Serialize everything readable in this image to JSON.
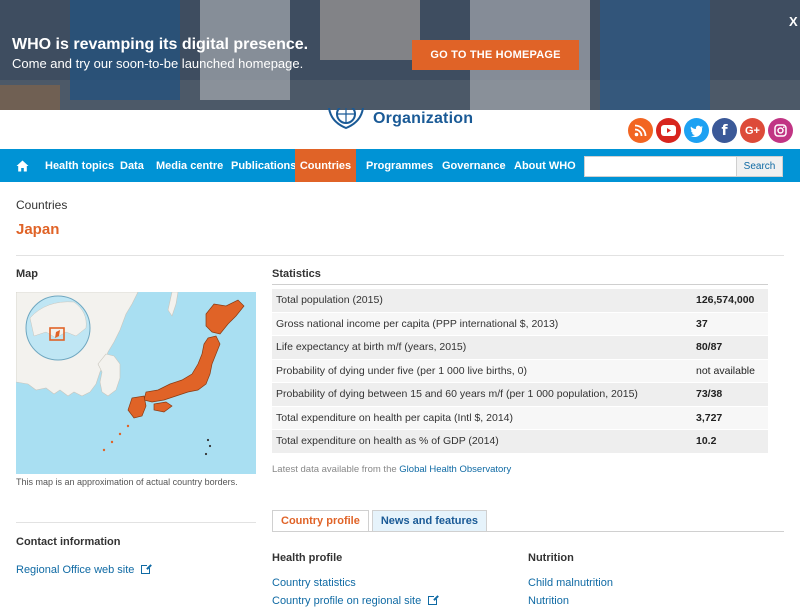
{
  "banner": {
    "title": "WHO is revamping its digital presence.",
    "subtitle": "Come and try our soon-to-be launched homepage.",
    "button": "GO TO THE HOMEPAGE",
    "close": "X"
  },
  "header": {
    "logo_text": "Organization",
    "social_icons": [
      "rss-icon",
      "youtube-icon",
      "twitter-icon",
      "facebook-icon",
      "google-plus-icon",
      "instagram-icon"
    ]
  },
  "nav": {
    "items": [
      "Health topics",
      "Data",
      "Media centre",
      "Publications",
      "Countries",
      "Programmes",
      "Governance",
      "About WHO"
    ],
    "active": "Countries",
    "search_button": "Search",
    "search_placeholder": ""
  },
  "page": {
    "breadcrumb": "Countries",
    "title": "Japan"
  },
  "map": {
    "heading": "Map",
    "caption": "This map is an approximation of actual country borders."
  },
  "stats": {
    "heading": "Statistics",
    "rows": [
      {
        "label": "Total population (2015)",
        "value": "126,574,000"
      },
      {
        "label": "Gross national income per capita (PPP international $, 2013)",
        "value": "37"
      },
      {
        "label": "Life expectancy at birth m/f (years, 2015)",
        "value": "80/87"
      },
      {
        "label": "Probability of dying under five (per 1 000 live births, 0)",
        "value": "not available"
      },
      {
        "label": "Probability of dying between 15 and 60 years m/f (per 1 000 population, 2015)",
        "value": "73/38"
      },
      {
        "label": "Total expenditure on health per capita (Intl $, 2014)",
        "value": "3,727"
      },
      {
        "label": "Total expenditure on health as % of GDP (2014)",
        "value": "10.2"
      }
    ],
    "latest_prefix": "Latest data available from the",
    "latest_link": "Global Health Observatory"
  },
  "tabs": [
    "Country profile",
    "News and features"
  ],
  "contact": {
    "heading": "Contact information",
    "regional_link": "Regional Office web site"
  },
  "profile": {
    "health_heading": "Health profile",
    "health_links": [
      "Country statistics",
      "Country profile on regional site"
    ],
    "nutrition_heading": "Nutrition",
    "nutrition_links": [
      "Child malnutrition",
      "Nutrition"
    ]
  },
  "colors": {
    "accent": "#e06327",
    "nav": "#0093d5",
    "link": "#0f6aa4",
    "land": "#e06327",
    "sea": "#a9dff2"
  }
}
